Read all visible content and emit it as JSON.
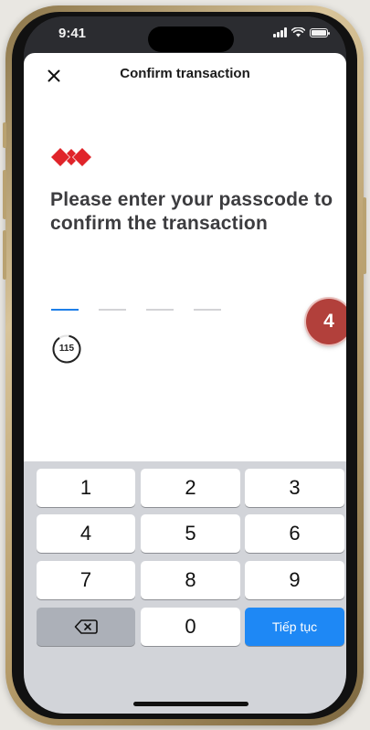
{
  "status_bar": {
    "time": "9:41"
  },
  "header": {
    "title": "Confirm transaction"
  },
  "prompt": {
    "text": "Please enter your passcode to confirm the transaction"
  },
  "passcode": {
    "length": 4,
    "entered": 0
  },
  "timer": {
    "value": "115"
  },
  "step_badge": {
    "label": "4"
  },
  "keypad": {
    "keys": [
      "1",
      "2",
      "3",
      "4",
      "5",
      "6",
      "7",
      "8",
      "9"
    ],
    "zero": "0",
    "continue_label": "Tiếp tục",
    "delete_icon": "backspace-icon"
  },
  "colors": {
    "accent": "#1e88f5",
    "brand": "#e0242a",
    "badge": "#b2403b"
  }
}
